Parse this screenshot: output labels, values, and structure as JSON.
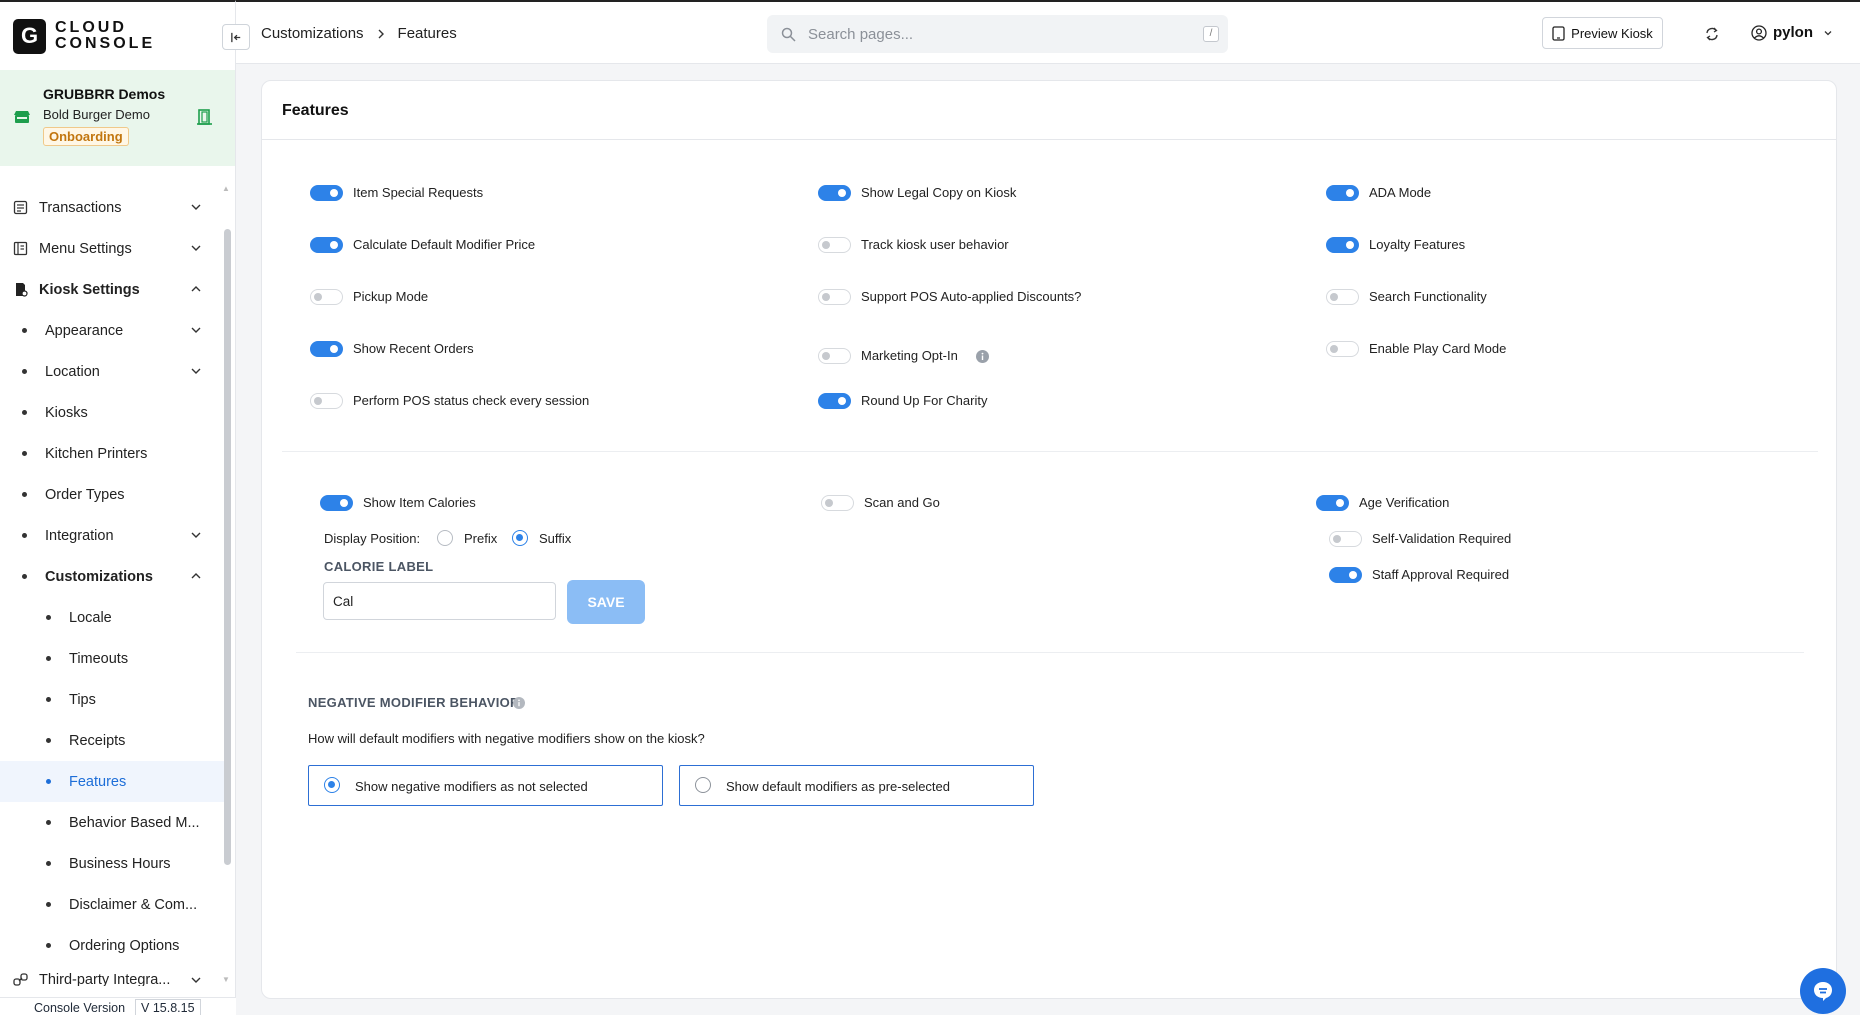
{
  "brand": {
    "logo_letter": "G",
    "line1": "CLOUD",
    "line2": "CONSOLE"
  },
  "org": {
    "name": "GRUBBRR Demos",
    "store": "Bold Burger Demo",
    "status": "Onboarding"
  },
  "nav": {
    "transactions": "Transactions",
    "menu_settings": "Menu Settings",
    "kiosk_settings": "Kiosk Settings",
    "appearance": "Appearance",
    "location": "Location",
    "kiosks": "Kiosks",
    "kitchen_printers": "Kitchen Printers",
    "order_types": "Order Types",
    "integration": "Integration",
    "customizations": "Customizations",
    "locale": "Locale",
    "timeouts": "Timeouts",
    "tips": "Tips",
    "receipts": "Receipts",
    "features": "Features",
    "behavior": "Behavior Based M...",
    "business_hours": "Business Hours",
    "disclaimer": "Disclaimer & Com...",
    "ordering_options": "Ordering Options",
    "third_party": "Third-party Integra..."
  },
  "footer": {
    "label": "Console Version",
    "version": "V 15.8.15"
  },
  "topbar": {
    "crumb1": "Customizations",
    "crumb2": "Features",
    "search_placeholder": "Search pages...",
    "search_shortcut": "/",
    "preview_label": "Preview Kiosk",
    "user": "pylon"
  },
  "page": {
    "title": "Features"
  },
  "features": {
    "col1": [
      {
        "label": "Item Special Requests",
        "on": true
      },
      {
        "label": "Calculate Default Modifier Price",
        "on": true
      },
      {
        "label": "Pickup Mode",
        "on": false
      },
      {
        "label": "Show Recent Orders",
        "on": true
      },
      {
        "label": "Perform POS status check every session",
        "on": false
      }
    ],
    "col2": [
      {
        "label": "Show Legal Copy on Kiosk",
        "on": true
      },
      {
        "label": "Track kiosk user behavior",
        "on": false
      },
      {
        "label": "Support POS Auto-applied Discounts?",
        "on": false
      },
      {
        "label": "Marketing Opt-In",
        "on": false
      },
      {
        "label": "Round Up For Charity",
        "on": true
      }
    ],
    "col3": [
      {
        "label": "ADA Mode",
        "on": true
      },
      {
        "label": "Loyalty Features",
        "on": true
      },
      {
        "label": "Search Functionality",
        "on": false
      },
      {
        "label": "Enable Play Card Mode",
        "on": false
      }
    ]
  },
  "calories": {
    "show_label": "Show Item Calories",
    "show_on": true,
    "display_position_label": "Display Position:",
    "prefix": "Prefix",
    "suffix": "Suffix",
    "selected": "suffix",
    "calorie_label_heading": "CALORIE LABEL",
    "calorie_value": "Cal",
    "save": "SAVE"
  },
  "scan_go": {
    "label": "Scan and Go",
    "on": false
  },
  "age": {
    "label": "Age Verification",
    "on": true,
    "self_validation": "Self-Validation Required",
    "self_on": false,
    "staff_approval": "Staff Approval Required",
    "staff_on": true
  },
  "negative": {
    "heading": "NEGATIVE MODIFIER BEHAVIOR",
    "question": "How will default modifiers with negative modifiers show on the kiosk?",
    "option1": "Show negative modifiers as not selected",
    "option2": "Show default modifiers as pre-selected",
    "selected": 1
  }
}
